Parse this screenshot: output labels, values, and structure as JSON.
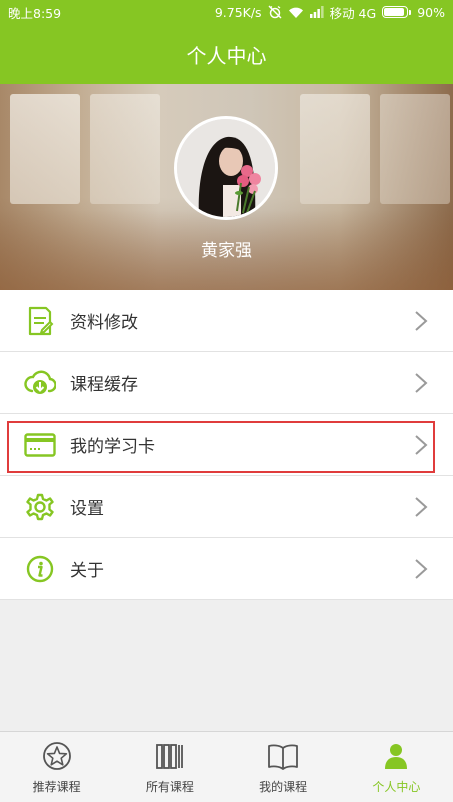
{
  "status_bar": {
    "time": "晚上8:59",
    "speed": "9.75K/s",
    "carrier": "移动 4G",
    "battery": "90%",
    "battery_level": 0.9
  },
  "header": {
    "title": "个人中心"
  },
  "profile": {
    "username": "黄家强"
  },
  "menu": {
    "items": [
      {
        "label": "资料修改",
        "icon": "edit-document-icon"
      },
      {
        "label": "课程缓存",
        "icon": "cloud-download-icon"
      },
      {
        "label": "我的学习卡",
        "icon": "card-icon"
      },
      {
        "label": "设置",
        "icon": "gear-icon"
      },
      {
        "label": "关于",
        "icon": "info-icon"
      }
    ]
  },
  "tabs": [
    {
      "label": "推荐课程",
      "icon": "star-icon"
    },
    {
      "label": "所有课程",
      "icon": "books-icon"
    },
    {
      "label": "我的课程",
      "icon": "open-book-icon"
    },
    {
      "label": "个人中心",
      "icon": "person-icon",
      "active": true
    }
  ],
  "colors": {
    "accent": "#86c623",
    "highlight": "#e03c3c"
  }
}
